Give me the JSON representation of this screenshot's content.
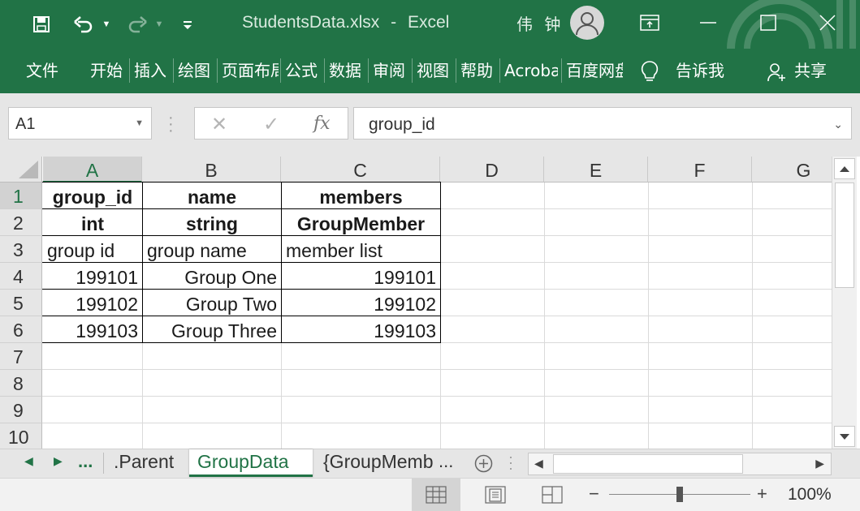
{
  "window": {
    "file_name": "StudentsData.xlsx",
    "separator": "-",
    "app_name": "Excel",
    "user_name": "伟 钟",
    "accent_color": "#217346"
  },
  "quick_access": {
    "icons": [
      "save-icon",
      "undo-icon",
      "redo-icon",
      "customize-icon"
    ]
  },
  "ribbon": {
    "tabs": [
      "文件",
      "开始",
      "插入",
      "绘图",
      "页面布局",
      "公式",
      "数据",
      "审阅",
      "视图",
      "帮助",
      "Acrobat",
      "百度网盘"
    ],
    "tell_me": "告诉我",
    "share": "共享"
  },
  "formula_bar": {
    "name_box": "A1",
    "formula": "group_id",
    "fx_label": "fx"
  },
  "grid": {
    "columns": [
      "A",
      "B",
      "C",
      "D",
      "E",
      "F",
      "G"
    ],
    "rows": [
      "1",
      "2",
      "3",
      "4",
      "5",
      "6",
      "7",
      "8",
      "9",
      "10"
    ],
    "cells": [
      [
        "group_id",
        "name",
        "members"
      ],
      [
        "int",
        "string",
        "GroupMember"
      ],
      [
        "group id",
        "group name",
        "member list"
      ],
      [
        "199101",
        "Group One",
        "199101"
      ],
      [
        "199102",
        "Group Two",
        "199102"
      ],
      [
        "199103",
        "Group Three",
        "199103"
      ]
    ]
  },
  "sheet_tabs": {
    "ellipsis": "...",
    "tabs": [
      ".Parent",
      "GroupData",
      "{GroupMemb"
    ],
    "active": "GroupData",
    "overflow": "..."
  },
  "status_bar": {
    "zoom_level": "100%",
    "zoom_minus": "−",
    "zoom_plus": "+"
  }
}
